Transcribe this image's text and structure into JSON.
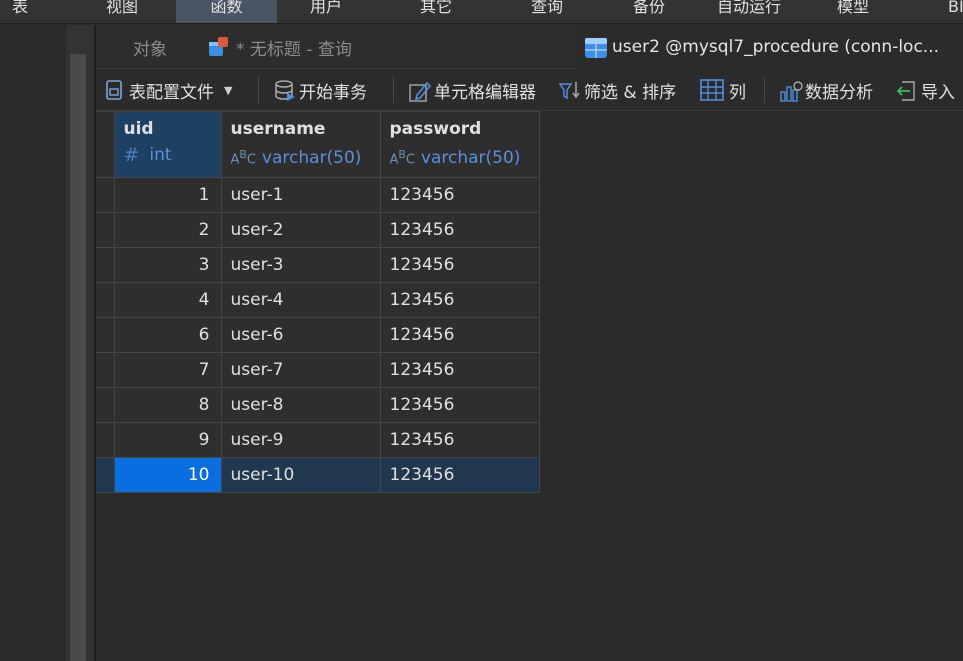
{
  "menu": {
    "items": [
      {
        "label": "表"
      },
      {
        "label": "视图"
      },
      {
        "label": "函数"
      },
      {
        "label": "用户"
      },
      {
        "label": "其它"
      },
      {
        "label": "查询"
      },
      {
        "label": "备份"
      },
      {
        "label": "自动运行"
      },
      {
        "label": "模型"
      },
      {
        "label": "BI"
      }
    ],
    "active_index": 2
  },
  "tabs": [
    {
      "label": "对象",
      "icon": "none"
    },
    {
      "label": "* 无标题 - 查询",
      "icon": "query-icon"
    },
    {
      "label": "user2 @mysql7_procedure (conn-loc...",
      "icon": "table-icon"
    }
  ],
  "toolbar": {
    "table_config": "表配置文件",
    "begin_transaction": "开始事务",
    "cell_editor": "单元格编辑器",
    "filter_sort": "筛选 & 排序",
    "columns": "列",
    "data_analysis": "数据分析",
    "import": "导入"
  },
  "grid": {
    "columns": [
      {
        "name": "uid",
        "type": "int"
      },
      {
        "name": "username",
        "type": "varchar(50)"
      },
      {
        "name": "password",
        "type": "varchar(50)"
      }
    ],
    "rows": [
      {
        "uid": "1",
        "username": "user-1",
        "password": "123456"
      },
      {
        "uid": "2",
        "username": "user-2",
        "password": "123456"
      },
      {
        "uid": "3",
        "username": "user-3",
        "password": "123456"
      },
      {
        "uid": "4",
        "username": "user-4",
        "password": "123456"
      },
      {
        "uid": "6",
        "username": "user-6",
        "password": "123456"
      },
      {
        "uid": "7",
        "username": "user-7",
        "password": "123456"
      },
      {
        "uid": "8",
        "username": "user-8",
        "password": "123456"
      },
      {
        "uid": "9",
        "username": "user-9",
        "password": "123456"
      },
      {
        "uid": "10",
        "username": "user-10",
        "password": "123456"
      }
    ],
    "selected_row_index": 8
  },
  "colors": {
    "selected_cell": "#0a6ee0",
    "selected_row": "#21364f",
    "type_text": "#5b8fd6"
  }
}
